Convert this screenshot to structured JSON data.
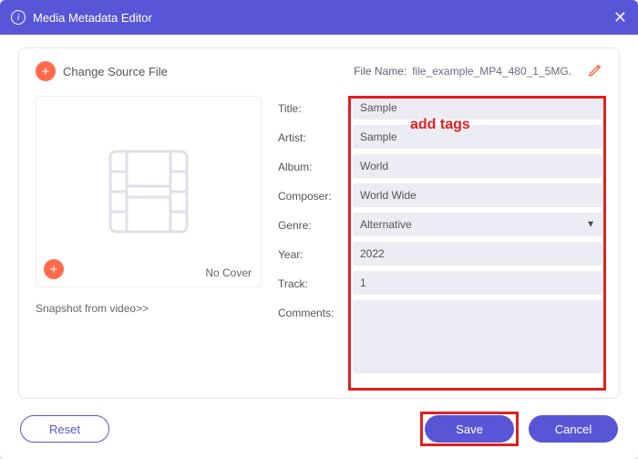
{
  "window": {
    "title": "Media Metadata Editor"
  },
  "header": {
    "change_source": "Change Source File",
    "file_name_label": "File Name:",
    "file_name_value": "file_example_MP4_480_1_5MG."
  },
  "annotation": "add tags",
  "cover": {
    "no_cover": "No Cover",
    "snapshot": "Snapshot from video>>"
  },
  "form": {
    "title_label": "Title:",
    "title_value": "Sample",
    "artist_label": "Artist:",
    "artist_value": "Sample",
    "album_label": "Album:",
    "album_value": "World",
    "composer_label": "Composer:",
    "composer_value": "World Wide",
    "genre_label": "Genre:",
    "genre_value": "Alternative",
    "year_label": "Year:",
    "year_value": "2022",
    "track_label": "Track:",
    "track_value": "1",
    "comments_label": "Comments:",
    "comments_value": ""
  },
  "footer": {
    "reset": "Reset",
    "save": "Save",
    "cancel": "Cancel"
  }
}
